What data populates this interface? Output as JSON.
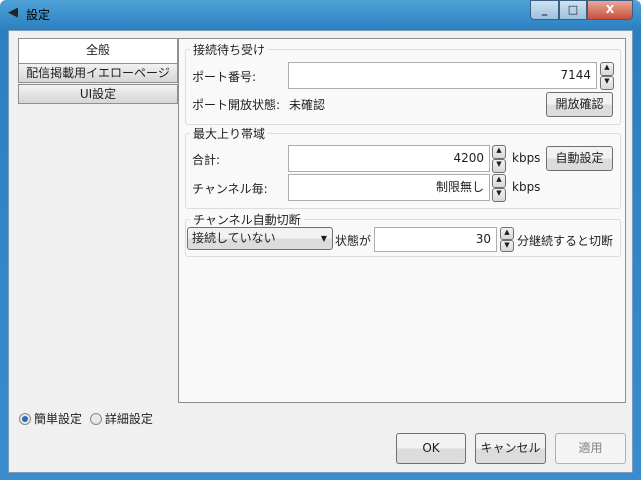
{
  "window": {
    "title": "設定",
    "minimize": "_",
    "maximize": "□",
    "close": "X"
  },
  "tabs": [
    {
      "label": "全般",
      "selected": true
    },
    {
      "label": "配信掲載用イエローページ"
    },
    {
      "label": "UI設定"
    }
  ],
  "listen": {
    "title": "接続待ち受け",
    "port_label": "ポート番号:",
    "port_value": "7144",
    "status_label": "ポート開放状態:",
    "status_value": "未確認",
    "check_button": "開放確認"
  },
  "bandwidth": {
    "title": "最大上り帯域",
    "total_label": "合計:",
    "total_value": "4200",
    "unit": "kbps",
    "auto_button": "自動設定",
    "per_channel_label": "チャンネル毎:",
    "per_channel_value": "制限無し"
  },
  "auto_disconnect": {
    "title": "チャンネル自動切断",
    "condition": "接続していない",
    "state_label": "状態が",
    "minutes_value": "30",
    "suffix": "分継続すると切断"
  },
  "mode": {
    "simple": "簡単設定",
    "advanced": "詳細設定",
    "selected": "simple"
  },
  "buttons": {
    "ok": "OK",
    "cancel": "キャンセル",
    "apply": "適用"
  }
}
